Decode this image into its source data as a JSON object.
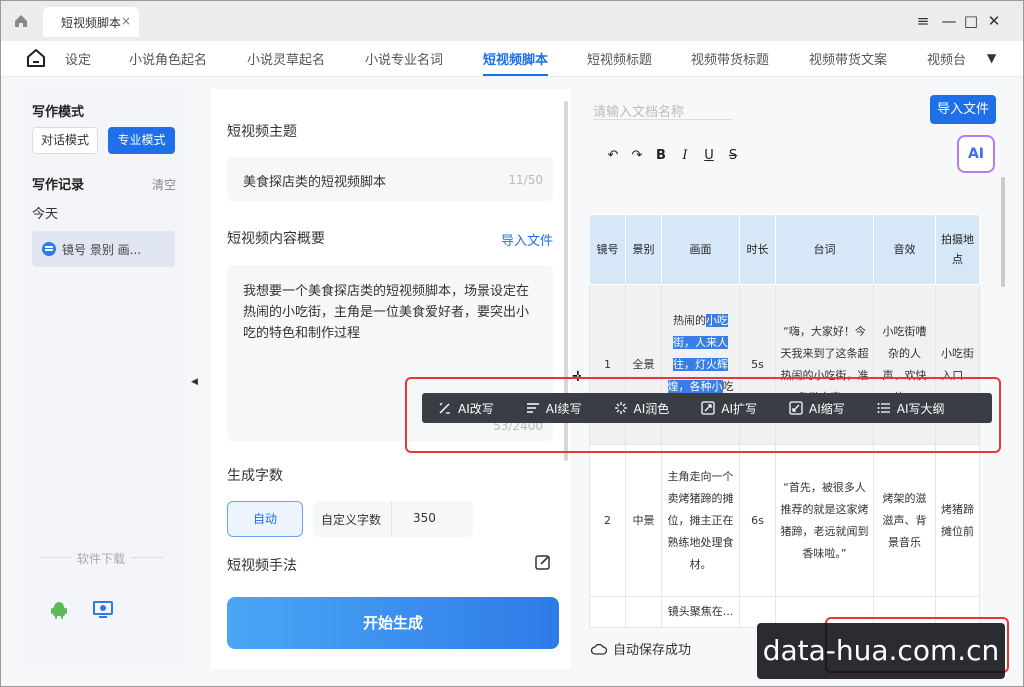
{
  "window": {
    "tab_title": "短视频脚本",
    "tab_close": "×",
    "controls": [
      "≡",
      "—",
      "□",
      "✕"
    ]
  },
  "nav": {
    "items": [
      "设定",
      "小说角色起名",
      "小说灵草起名",
      "小说专业名词",
      "短视频脚本",
      "短视频标题",
      "视频带货标题",
      "视频带货文案",
      "视频台"
    ],
    "active": "短视频脚本",
    "more": "▼"
  },
  "sidebar": {
    "mode_title": "写作模式",
    "mode_dialog": "对话模式",
    "mode_pro": "专业模式",
    "record_title": "写作记录",
    "clear": "清空",
    "today": "今天",
    "record_item": "镜号 景别 画...",
    "download": "软件下载"
  },
  "form": {
    "topic_label": "短视频主题",
    "topic_value": "美食探店类的短视频脚本",
    "topic_count": "11/50",
    "summary_label": "短视频内容概要",
    "import_file": "导入文件",
    "summary_value": "我想要一个美食探店类的短视频脚本，场景设定在热闹的小吃街，主角是一位美食爱好者，要突出小吃的特色和制作过程",
    "summary_count": "53/2400",
    "words_label": "生成字数",
    "auto": "自动",
    "custom_label": "自定义字数",
    "custom_value": "350",
    "technique_label": "短视频手法",
    "start_button": "开始生成"
  },
  "document": {
    "name_placeholder": "请输入文档名称",
    "import_button": "导入文件",
    "toolbar": [
      "↶",
      "↷",
      "B",
      "I",
      "U",
      "S"
    ],
    "ai_badge": "AI",
    "headers": [
      "镜号",
      "景别",
      "画面",
      "时长",
      "台词",
      "音效",
      "拍摄地点"
    ],
    "rows": [
      {
        "no": "1",
        "shot": "全景",
        "scene_plain": "热闹的",
        "scene_sel": "小吃街，人来人往，灯火辉煌，各种小",
        "scene_tail": "吃摊...",
        "duration": "5s",
        "line": "“嗨，大家好！今天我来到了这条超热闹的小吃街，准备带大家...",
        "sound": "小吃街嘈杂的人声、欢快的...",
        "place": "小吃街入口..."
      },
      {
        "no": "2",
        "shot": "中景",
        "scene": "主角走向一个卖烤猪蹄的摊位，摊主正在熟练地处理食材。",
        "duration": "6s",
        "line": "“首先，被很多人推荐的就是这家烤猪蹄，老远就闻到香味啦。”",
        "sound": "烤架的滋滋声、背景音乐",
        "place": "烤猪蹄摊位前"
      },
      {
        "no": "",
        "shot": "",
        "scene": "镜头聚焦在...",
        "duration": "",
        "line": "",
        "sound": "",
        "place": ""
      }
    ],
    "ai_tools": [
      "AI改写",
      "AI续写",
      "AI润色",
      "AI扩写",
      "AI缩写",
      "AI写大纲"
    ],
    "status": "自动保存成功"
  },
  "watermark": "data-hua.com.cn",
  "colors": {
    "accent": "#1e6fe8",
    "highlight_box": "#e53a33",
    "table_header": "#d6e8f7",
    "ai_toolbar": "#3a3d44"
  }
}
